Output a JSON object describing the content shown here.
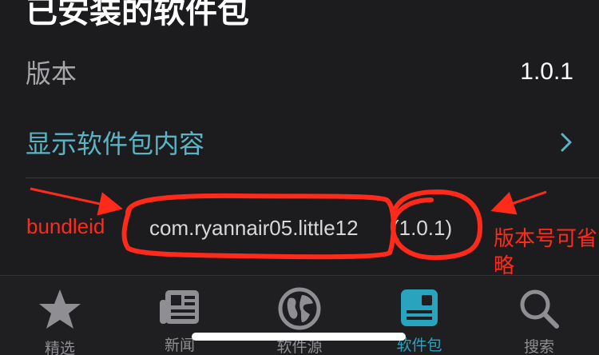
{
  "header": {
    "section_title": "已安装的软件包"
  },
  "rows": {
    "version_label": "版本",
    "version_value": "1.0.1",
    "show_contents_label": "显示软件包内容"
  },
  "package": {
    "bundle_id": "com.ryannair05.little12",
    "version": "(1.0.1)"
  },
  "annotations": {
    "left": "bundleid",
    "right": "版本号可省略",
    "color": "#ff2a1a"
  },
  "tabbar": {
    "active_color": "#2aa3bf",
    "tabs": [
      {
        "label": "精选",
        "icon": "star-icon"
      },
      {
        "label": "新闻",
        "icon": "newspaper-icon"
      },
      {
        "label": "软件源",
        "icon": "globe-icon"
      },
      {
        "label": "软件包",
        "icon": "package-icon",
        "active": true
      },
      {
        "label": "搜索",
        "icon": "search-icon"
      }
    ]
  }
}
